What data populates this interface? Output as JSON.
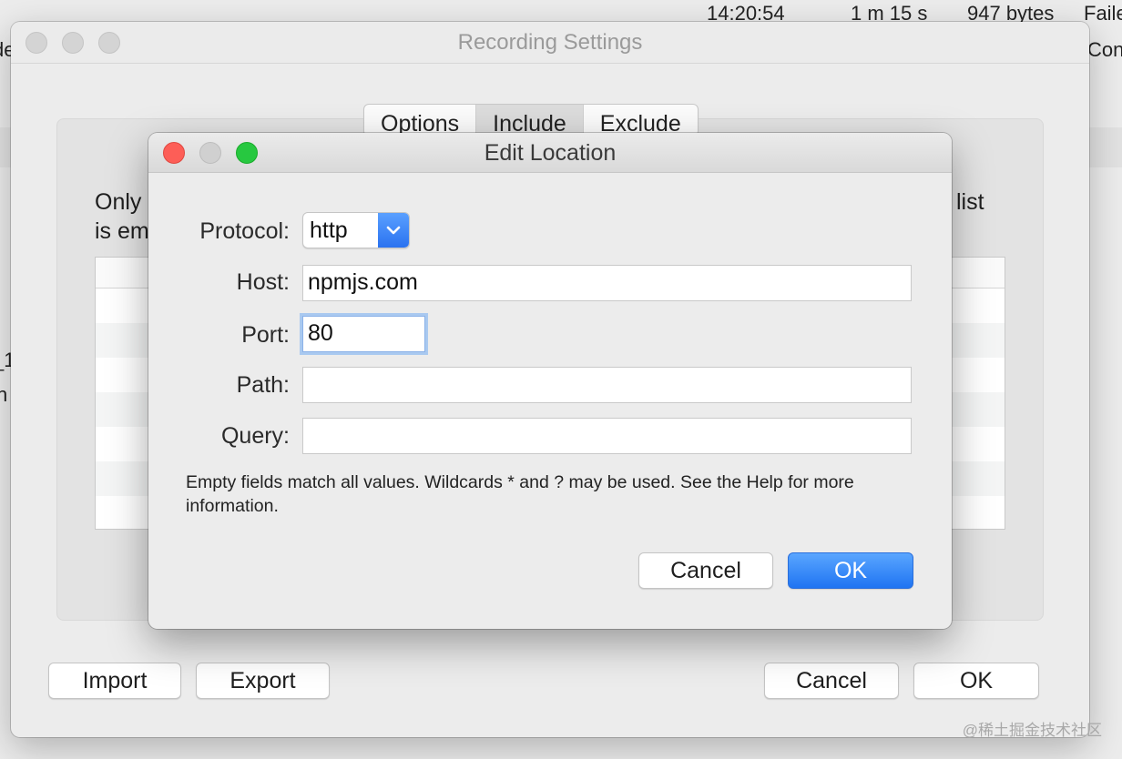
{
  "background": {
    "status_time": "14:20:54",
    "status_duration": "1 m 15 s",
    "status_size": "947 bytes",
    "status_result": "Faile",
    "edge_right_text": "Con",
    "edge_left_text_1": "de",
    "edge_left_text_2": "_1",
    "edge_left_text_3": "n"
  },
  "recording_settings": {
    "title": "Recording Settings",
    "tabs": [
      {
        "label": "Options",
        "selected": false
      },
      {
        "label": "Include",
        "selected": true
      },
      {
        "label": "Exclude",
        "selected": false
      }
    ],
    "description_line1_start": "Only",
    "description_line1_end": "list",
    "description_line2_start": "is em",
    "buttons": {
      "import": "Import",
      "export": "Export",
      "cancel": "Cancel",
      "ok": "OK"
    }
  },
  "edit_location": {
    "title": "Edit Location",
    "fields": {
      "protocol_label": "Protocol:",
      "protocol_value": "http",
      "host_label": "Host:",
      "host_value": "npmjs.com",
      "port_label": "Port:",
      "port_value": "80",
      "path_label": "Path:",
      "path_value": "",
      "query_label": "Query:",
      "query_value": ""
    },
    "hint": "Empty fields match all values. Wildcards * and ? may be used. See the Help for more information.",
    "buttons": {
      "cancel": "Cancel",
      "ok": "OK"
    },
    "colors": {
      "accent": "#1f74f2",
      "close": "#fd5e57",
      "zoom": "#27c840"
    }
  },
  "watermark": "@稀土掘金技术社区"
}
